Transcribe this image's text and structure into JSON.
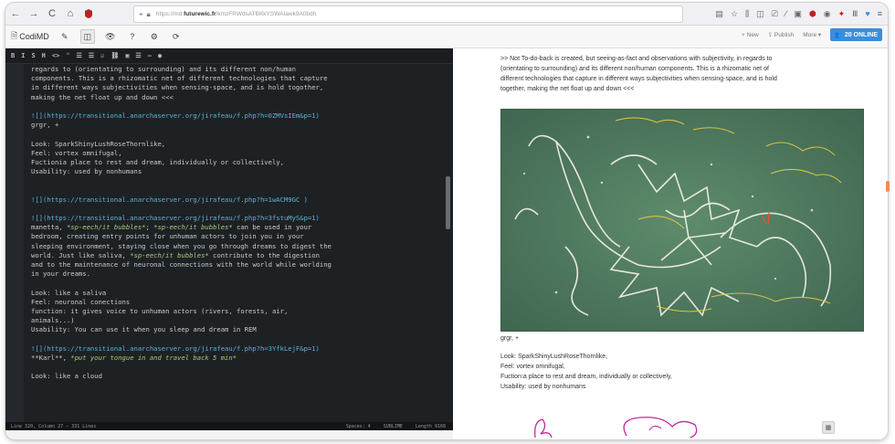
{
  "browser": {
    "url_prefix": "https://md.",
    "url_domain": "futurewic.fr",
    "url_rest": "/kmzFRWdsATBKkYSWAIawk9A0bdh",
    "nav": [
      "←",
      "→",
      "C",
      "⌂"
    ]
  },
  "app": {
    "brand": "CodiMD",
    "new_label": "+ New",
    "publish_label": "Publish",
    "more_label": "More ▾",
    "online_label": "20 ONLINE"
  },
  "editor": {
    "md_toolbar": [
      "B",
      "I",
      "S",
      "H",
      "<>",
      "❝",
      "☰",
      "☰",
      "☑",
      "⛓",
      "▣",
      "☰",
      "—",
      "●"
    ],
    "lines": [
      [
        {
          "t": "regards to (orientating to surrounding) and its different non/human"
        }
      ],
      [
        {
          "t": "components. This is a rhizomatic net of different technologies that capture"
        }
      ],
      [
        {
          "t": "in different ways subjectivities when sensing-space, and is hold togother,"
        }
      ],
      [
        {
          "t": "making the net float up and down <<<"
        }
      ],
      [
        {
          "t": ""
        }
      ],
      [
        {
          "t": "![](https://transitional.anarchaserver.org/jirafeau/f.php?h=0ZMVsIEm&p=1)",
          "c": "link"
        }
      ],
      [
        {
          "t": "grgr, +"
        }
      ],
      [
        {
          "t": ""
        }
      ],
      [
        {
          "t": "Look: SparkShinyLushRoseThornlike,"
        }
      ],
      [
        {
          "t": "Feel: vortex omnifugal,"
        }
      ],
      [
        {
          "t": "Fuctionia place to rest and dream, individually or collectively,"
        }
      ],
      [
        {
          "t": "Usability: used by nonhumans"
        }
      ],
      [
        {
          "t": ""
        }
      ],
      [
        {
          "t": ""
        }
      ],
      [
        {
          "t": "![](https://transitional.anarchaserver.org/jirafeau/f.php?h=1wACM9GC )",
          "c": "link"
        }
      ],
      [
        {
          "t": ""
        }
      ],
      [
        {
          "t": "![](https://transitional.anarchaserver.org/jirafeau/f.php?h=3fstuMyS&p=1)",
          "c": "link"
        }
      ],
      [
        {
          "t": "manetta, "
        },
        {
          "t": "*sp-eech/it bubbles*",
          "c": "em"
        },
        {
          "t": "; "
        },
        {
          "t": "*sp-eech/it bubbles*",
          "c": "em"
        },
        {
          "t": " can be used in your"
        }
      ],
      [
        {
          "t": "bedroom, creating entry points for unhuman actors to join you in your"
        }
      ],
      [
        {
          "t": "sleeping environment, staying close when you go through dreams to digest the"
        }
      ],
      [
        {
          "t": "world. Just like saliva, "
        },
        {
          "t": "*sp-eech/it bubbles*",
          "c": "em"
        },
        {
          "t": " contribute to the digestion"
        }
      ],
      [
        {
          "t": "and to the maintenance of neuronal connections with the world while worlding"
        }
      ],
      [
        {
          "t": "in your dreams."
        }
      ],
      [
        {
          "t": ""
        }
      ],
      [
        {
          "t": "Look: like a saliva"
        }
      ],
      [
        {
          "t": "Feel: neuronal conections"
        }
      ],
      [
        {
          "t": "function: it gives voice to unhuman actors (rivers, forests, air,"
        }
      ],
      [
        {
          "t": "animals...)"
        }
      ],
      [
        {
          "t": "Usability: You can use it when you sleep and dream in REM"
        }
      ],
      [
        {
          "t": ""
        }
      ],
      [
        {
          "t": "![](https://transitional.anarchaserver.org/jirafeau/f.php?h=3YfkLejF&p=1)",
          "c": "link"
        }
      ],
      [
        {
          "t": "**Karl**, "
        },
        {
          "t": "*put your tongue in and travel back 5 min*",
          "c": "em"
        }
      ],
      [
        {
          "t": ""
        }
      ],
      [
        {
          "t": "Look: like a cloud"
        }
      ]
    ],
    "status_left": "Line 320, Column 27 — 331 Lines",
    "status_right": [
      "Spaces: 4",
      "SUBLIME",
      "Length 9168"
    ]
  },
  "preview": {
    "intro_lines": [
      ">> Not To-do-back is created, but seeing-as-fact and observations with subjectivity, in regards to",
      "(orientating to surrounding) and its different non/human components. This is a rhizomatic net of",
      "different technologies that capture in different ways subjectivities when sensing-space, and is hold",
      "together, making the net float up and down <<<"
    ],
    "caption": "grgr, +",
    "desc_lines": [
      "Look: SparkShinyLushRoseThornlike,",
      "Feel: vortex omnifugal,",
      "Fuction:a place to rest and dream, individually or collectively,",
      "Usability: used by nonhumans"
    ],
    "drawing_name": "chalk-drawing-image"
  }
}
